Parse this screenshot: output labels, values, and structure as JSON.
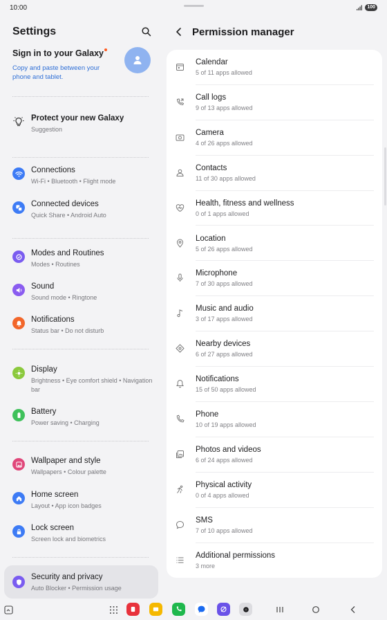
{
  "status": {
    "time": "10:00",
    "battery": "100"
  },
  "settings": {
    "title": "Settings",
    "signin": {
      "title": "Sign in to your Galaxy",
      "subtitle": "Copy and paste between your phone and tablet."
    },
    "items": [
      {
        "title": "Protect your new Galaxy",
        "subtitle": "Suggestion",
        "icon": "lightbulb-icon"
      },
      {
        "title": "Connections",
        "subtitle": "Wi-Fi  •  Bluetooth  •  Flight mode",
        "icon": "wifi-icon",
        "color": "#3d7bf5"
      },
      {
        "title": "Connected devices",
        "subtitle": "Quick Share  •  Android Auto",
        "icon": "devices-icon",
        "color": "#3d7bf5"
      },
      {
        "title": "Modes and Routines",
        "subtitle": "Modes  •  Routines",
        "icon": "modes-icon",
        "color": "#7a5cf0"
      },
      {
        "title": "Sound",
        "subtitle": "Sound mode  •  Ringtone",
        "icon": "sound-icon",
        "color": "#8a5cf0"
      },
      {
        "title": "Notifications",
        "subtitle": "Status bar  •  Do not disturb",
        "icon": "notifications-icon",
        "color": "#f2662a"
      },
      {
        "title": "Display",
        "subtitle": "Brightness  •  Eye comfort shield  •  Navigation bar",
        "icon": "display-icon",
        "color": "#8bc93d"
      },
      {
        "title": "Battery",
        "subtitle": "Power saving  •  Charging",
        "icon": "battery-icon",
        "color": "#3fc15b"
      },
      {
        "title": "Wallpaper and style",
        "subtitle": "Wallpapers  •  Colour palette",
        "icon": "wallpaper-icon",
        "color": "#e0477a"
      },
      {
        "title": "Home screen",
        "subtitle": "Layout  •  App icon badges",
        "icon": "home-icon",
        "color": "#3d7bf5"
      },
      {
        "title": "Lock screen",
        "subtitle": "Screen lock and biometrics",
        "icon": "lock-icon",
        "color": "#3d7bf5"
      },
      {
        "title": "Security and privacy",
        "subtitle": "Auto Blocker  •  Permission usage",
        "icon": "shield-icon",
        "color": "#7a5cf0"
      }
    ]
  },
  "permission_manager": {
    "title": "Permission manager",
    "items": [
      {
        "name": "Calendar",
        "count": "5 of 11 apps allowed",
        "icon": "calendar-icon"
      },
      {
        "name": "Call logs",
        "count": "9 of 13 apps allowed",
        "icon": "call-log-icon"
      },
      {
        "name": "Camera",
        "count": "4 of 26 apps allowed",
        "icon": "camera-icon"
      },
      {
        "name": "Contacts",
        "count": "11 of 30 apps allowed",
        "icon": "contacts-icon"
      },
      {
        "name": "Health, fitness and wellness",
        "count": "0 of 1 apps allowed",
        "icon": "health-icon"
      },
      {
        "name": "Location",
        "count": "5 of 26 apps allowed",
        "icon": "location-icon"
      },
      {
        "name": "Microphone",
        "count": "7 of 30 apps allowed",
        "icon": "microphone-icon"
      },
      {
        "name": "Music and audio",
        "count": "3 of 17 apps allowed",
        "icon": "music-icon"
      },
      {
        "name": "Nearby devices",
        "count": "6 of 27 apps allowed",
        "icon": "nearby-icon"
      },
      {
        "name": "Notifications",
        "count": "15 of 50 apps allowed",
        "icon": "bell-icon"
      },
      {
        "name": "Phone",
        "count": "10 of 19 apps allowed",
        "icon": "phone-icon"
      },
      {
        "name": "Photos and videos",
        "count": "6 of 24 apps allowed",
        "icon": "photos-icon"
      },
      {
        "name": "Physical activity",
        "count": "0 of 4 apps allowed",
        "icon": "activity-icon"
      },
      {
        "name": "SMS",
        "count": "7 of 10 apps allowed",
        "icon": "sms-icon"
      },
      {
        "name": "Additional permissions",
        "count": "3 more",
        "icon": "list-icon"
      }
    ]
  }
}
